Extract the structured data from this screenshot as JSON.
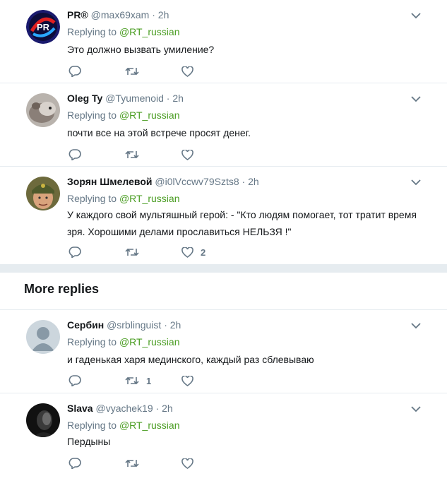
{
  "thread": [
    {
      "name": "PR®",
      "handle": "@max69xam",
      "time": "2h",
      "replying_label": "Replying to",
      "mention": "@RT_russian",
      "text": "Это должно вызвать умиление?",
      "likes": "",
      "retweets": "",
      "avatar_icon": "pr-logo-avatar"
    },
    {
      "name": "Oleg Ty",
      "handle": "@Tyumenoid",
      "time": "2h",
      "replying_label": "Replying to",
      "mention": "@RT_russian",
      "text": "почти все на этой встрече просят денег.",
      "likes": "",
      "retweets": "",
      "avatar_icon": "hamster-avatar"
    },
    {
      "name": "Зорян Шмелевой",
      "handle": "@i0lVccwv79Szts8",
      "time": "2h",
      "replying_label": "Replying to",
      "mention": "@RT_russian",
      "text": "У каждого свой мультяшный герой: - \"Кто людям помогает, тот тратит время зря. Хорошими делами прославиться НЕЛЬЗЯ !\"",
      "likes": "2",
      "retweets": "",
      "avatar_icon": "man-helmet-avatar"
    }
  ],
  "more_replies": {
    "title": "More replies",
    "items": [
      {
        "name": "Сербин",
        "handle": "@srblinguist",
        "time": "2h",
        "replying_label": "Replying to",
        "mention": "@RT_russian",
        "text": "и гаденькая харя мединского, каждый раз сблевываю",
        "likes": "",
        "retweets": "1",
        "avatar_icon": "default-egg-avatar"
      },
      {
        "name": "Slava",
        "handle": "@vyachek19",
        "time": "2h",
        "replying_label": "Replying to",
        "mention": "@RT_russian",
        "text": "Пердыны",
        "likes": "",
        "retweets": "",
        "avatar_icon": "dark-portrait-avatar"
      }
    ]
  },
  "colors": {
    "mention": "#4a9d22",
    "muted": "#657786",
    "divider": "#e6ecf0",
    "text": "#14171a"
  },
  "icons": [
    "reply-icon",
    "retweet-icon",
    "like-icon",
    "chevron-down-icon"
  ]
}
